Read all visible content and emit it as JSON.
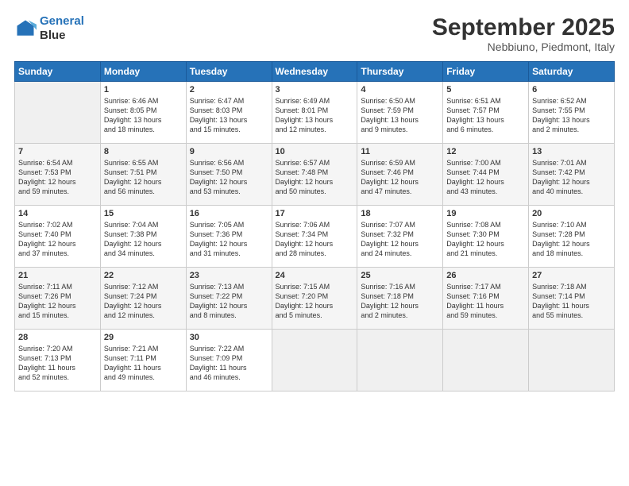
{
  "header": {
    "logo_line1": "General",
    "logo_line2": "Blue",
    "month": "September 2025",
    "location": "Nebbiuno, Piedmont, Italy"
  },
  "weekdays": [
    "Sunday",
    "Monday",
    "Tuesday",
    "Wednesday",
    "Thursday",
    "Friday",
    "Saturday"
  ],
  "weeks": [
    [
      {
        "day": "",
        "content": ""
      },
      {
        "day": "1",
        "content": "Sunrise: 6:46 AM\nSunset: 8:05 PM\nDaylight: 13 hours\nand 18 minutes."
      },
      {
        "day": "2",
        "content": "Sunrise: 6:47 AM\nSunset: 8:03 PM\nDaylight: 13 hours\nand 15 minutes."
      },
      {
        "day": "3",
        "content": "Sunrise: 6:49 AM\nSunset: 8:01 PM\nDaylight: 13 hours\nand 12 minutes."
      },
      {
        "day": "4",
        "content": "Sunrise: 6:50 AM\nSunset: 7:59 PM\nDaylight: 13 hours\nand 9 minutes."
      },
      {
        "day": "5",
        "content": "Sunrise: 6:51 AM\nSunset: 7:57 PM\nDaylight: 13 hours\nand 6 minutes."
      },
      {
        "day": "6",
        "content": "Sunrise: 6:52 AM\nSunset: 7:55 PM\nDaylight: 13 hours\nand 2 minutes."
      }
    ],
    [
      {
        "day": "7",
        "content": "Sunrise: 6:54 AM\nSunset: 7:53 PM\nDaylight: 12 hours\nand 59 minutes."
      },
      {
        "day": "8",
        "content": "Sunrise: 6:55 AM\nSunset: 7:51 PM\nDaylight: 12 hours\nand 56 minutes."
      },
      {
        "day": "9",
        "content": "Sunrise: 6:56 AM\nSunset: 7:50 PM\nDaylight: 12 hours\nand 53 minutes."
      },
      {
        "day": "10",
        "content": "Sunrise: 6:57 AM\nSunset: 7:48 PM\nDaylight: 12 hours\nand 50 minutes."
      },
      {
        "day": "11",
        "content": "Sunrise: 6:59 AM\nSunset: 7:46 PM\nDaylight: 12 hours\nand 47 minutes."
      },
      {
        "day": "12",
        "content": "Sunrise: 7:00 AM\nSunset: 7:44 PM\nDaylight: 12 hours\nand 43 minutes."
      },
      {
        "day": "13",
        "content": "Sunrise: 7:01 AM\nSunset: 7:42 PM\nDaylight: 12 hours\nand 40 minutes."
      }
    ],
    [
      {
        "day": "14",
        "content": "Sunrise: 7:02 AM\nSunset: 7:40 PM\nDaylight: 12 hours\nand 37 minutes."
      },
      {
        "day": "15",
        "content": "Sunrise: 7:04 AM\nSunset: 7:38 PM\nDaylight: 12 hours\nand 34 minutes."
      },
      {
        "day": "16",
        "content": "Sunrise: 7:05 AM\nSunset: 7:36 PM\nDaylight: 12 hours\nand 31 minutes."
      },
      {
        "day": "17",
        "content": "Sunrise: 7:06 AM\nSunset: 7:34 PM\nDaylight: 12 hours\nand 28 minutes."
      },
      {
        "day": "18",
        "content": "Sunrise: 7:07 AM\nSunset: 7:32 PM\nDaylight: 12 hours\nand 24 minutes."
      },
      {
        "day": "19",
        "content": "Sunrise: 7:08 AM\nSunset: 7:30 PM\nDaylight: 12 hours\nand 21 minutes."
      },
      {
        "day": "20",
        "content": "Sunrise: 7:10 AM\nSunset: 7:28 PM\nDaylight: 12 hours\nand 18 minutes."
      }
    ],
    [
      {
        "day": "21",
        "content": "Sunrise: 7:11 AM\nSunset: 7:26 PM\nDaylight: 12 hours\nand 15 minutes."
      },
      {
        "day": "22",
        "content": "Sunrise: 7:12 AM\nSunset: 7:24 PM\nDaylight: 12 hours\nand 12 minutes."
      },
      {
        "day": "23",
        "content": "Sunrise: 7:13 AM\nSunset: 7:22 PM\nDaylight: 12 hours\nand 8 minutes."
      },
      {
        "day": "24",
        "content": "Sunrise: 7:15 AM\nSunset: 7:20 PM\nDaylight: 12 hours\nand 5 minutes."
      },
      {
        "day": "25",
        "content": "Sunrise: 7:16 AM\nSunset: 7:18 PM\nDaylight: 12 hours\nand 2 minutes."
      },
      {
        "day": "26",
        "content": "Sunrise: 7:17 AM\nSunset: 7:16 PM\nDaylight: 11 hours\nand 59 minutes."
      },
      {
        "day": "27",
        "content": "Sunrise: 7:18 AM\nSunset: 7:14 PM\nDaylight: 11 hours\nand 55 minutes."
      }
    ],
    [
      {
        "day": "28",
        "content": "Sunrise: 7:20 AM\nSunset: 7:13 PM\nDaylight: 11 hours\nand 52 minutes."
      },
      {
        "day": "29",
        "content": "Sunrise: 7:21 AM\nSunset: 7:11 PM\nDaylight: 11 hours\nand 49 minutes."
      },
      {
        "day": "30",
        "content": "Sunrise: 7:22 AM\nSunset: 7:09 PM\nDaylight: 11 hours\nand 46 minutes."
      },
      {
        "day": "",
        "content": ""
      },
      {
        "day": "",
        "content": ""
      },
      {
        "day": "",
        "content": ""
      },
      {
        "day": "",
        "content": ""
      }
    ]
  ]
}
